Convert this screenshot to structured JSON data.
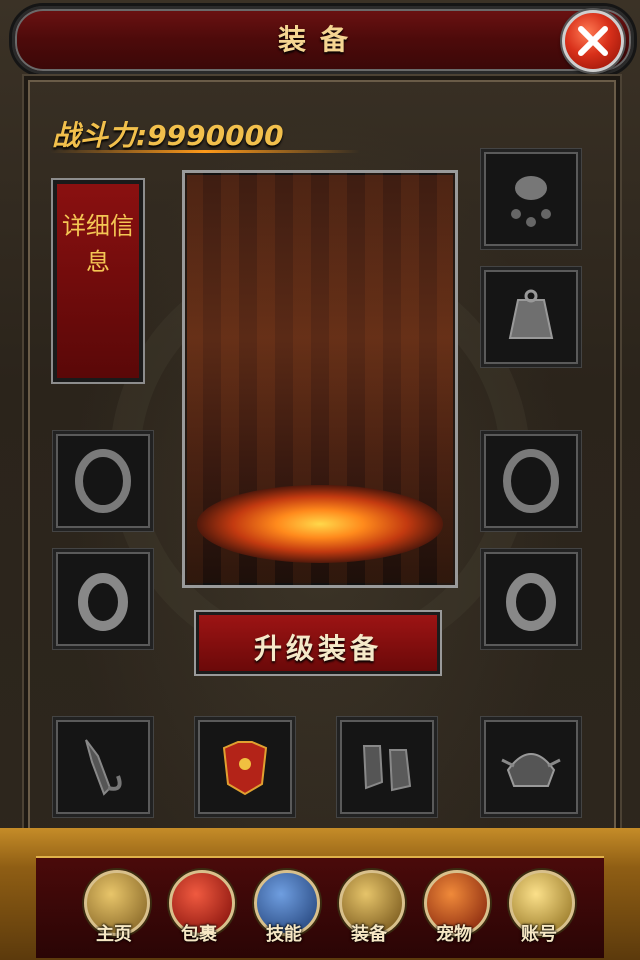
{
  "header": {
    "title": "装备"
  },
  "stats": {
    "power_label": "战斗力:",
    "power_value": "9990000"
  },
  "detail_button": {
    "label": "详细信息"
  },
  "upgrade_button": {
    "label": "升级装备"
  },
  "slots": [
    {
      "name": "bell-charm",
      "icon": "bell-charm-icon"
    },
    {
      "name": "amulet",
      "icon": "amulet-icon"
    },
    {
      "name": "bracelet-left",
      "icon": "bracelet-icon"
    },
    {
      "name": "bracelet-right",
      "icon": "bracelet-icon"
    },
    {
      "name": "ring-left",
      "icon": "ring-icon"
    },
    {
      "name": "ring-right",
      "icon": "ring-icon"
    },
    {
      "name": "weapon",
      "icon": "weapon-icon"
    },
    {
      "name": "armor",
      "icon": "armor-icon"
    },
    {
      "name": "boots",
      "icon": "boots-icon"
    },
    {
      "name": "helmet",
      "icon": "helmet-icon"
    }
  ],
  "nav": [
    {
      "label": "主页",
      "icon": "home-warrior-icon",
      "color": "#c89a3a"
    },
    {
      "label": "包裹",
      "icon": "bag-icon",
      "color": "#c0231b"
    },
    {
      "label": "技能",
      "icon": "skill-book-icon",
      "color": "#2f5fa8"
    },
    {
      "label": "装备",
      "icon": "equipment-icon",
      "color": "#b9892a"
    },
    {
      "label": "宠物",
      "icon": "pet-dragon-icon",
      "color": "#c8461a"
    },
    {
      "label": "账号",
      "icon": "account-scroll-icon",
      "color": "#e6c45a"
    }
  ]
}
